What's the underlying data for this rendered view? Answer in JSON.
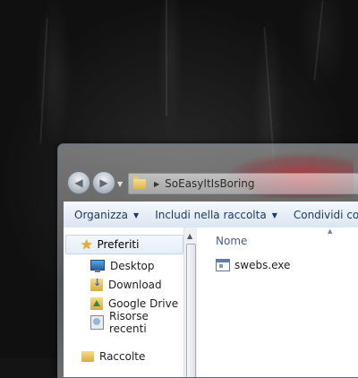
{
  "explorer": {
    "address_crumb": "SoEasyItIsBoring",
    "toolbar": {
      "organize": "Organizza",
      "include_in_library": "Includi nella raccolta",
      "share": "Condividi con"
    },
    "navigation": {
      "favorites": "Preferiti",
      "items": [
        "Desktop",
        "Download",
        "Google Drive",
        "Risorse recenti"
      ],
      "libraries": "Raccolte"
    },
    "file_list": {
      "column_name": "Nome",
      "files": [
        {
          "name": "swebs.exe"
        }
      ]
    }
  },
  "icons": {
    "back": "back-arrow-icon",
    "forward": "forward-arrow-icon",
    "folder": "folder-icon",
    "favorites": "star-icon",
    "executable": "exe-file-icon"
  }
}
